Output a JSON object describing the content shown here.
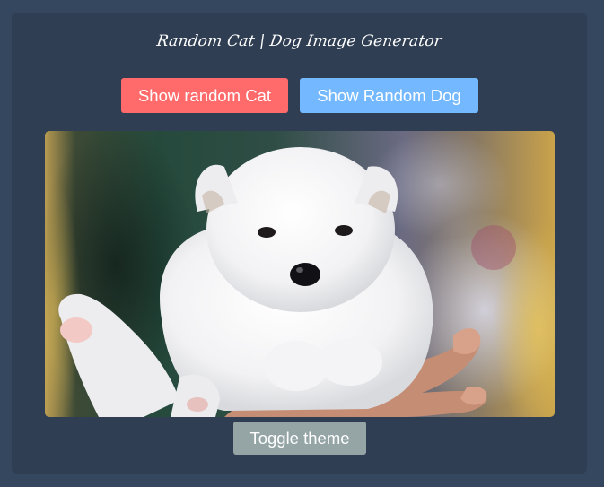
{
  "app": {
    "title": "Random Cat | Dog Image Generator"
  },
  "buttons": {
    "cat_label": "Show random Cat",
    "dog_label": "Show Random Dog",
    "theme_label": "Toggle theme"
  },
  "image": {
    "subject": "white fluffy puppy held in a hand"
  },
  "colors": {
    "page_background": "#34475e",
    "card_background": "#2f3e52",
    "cat_button": "#ff6b6b",
    "dog_button": "#74b9ff",
    "theme_button": "#95a5a6"
  }
}
